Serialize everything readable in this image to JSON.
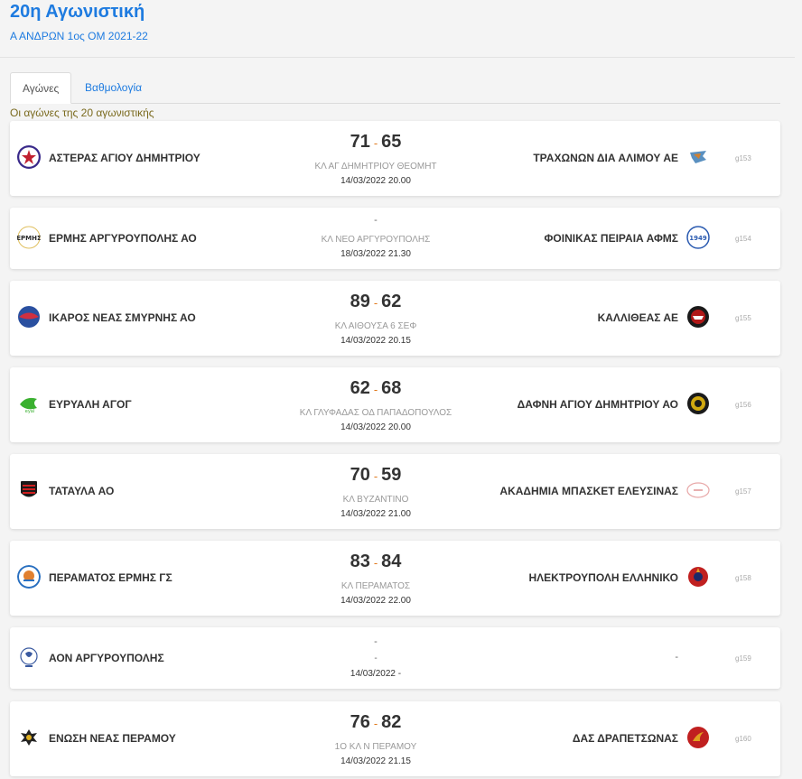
{
  "header": {
    "title": "20η Αγωνιστική",
    "subtitle": "Α ΑΝΔΡΩΝ 1ος ΟΜ 2021-22"
  },
  "tabs": [
    {
      "label": "Αγώνες"
    },
    {
      "label": "Βαθμολογία"
    }
  ],
  "caption": "Οι αγώνες της 20 αγωνιστικής",
  "matches": [
    {
      "home": "ΑΣΤΕΡΑΣ ΑΓΙΟΥ ΔΗΜΗΤΡΙΟΥ",
      "away": "ΤΡΑΧΩΝΩΝ ΔΙΑ ΑΛΙΜΟΥ ΑΕ",
      "home_score": "71",
      "away_score": "65",
      "venue": "ΚΛ ΑΓ ΔΗΜΗΤΡΙΟΥ ΘΕΟΜΗΤ",
      "date": "14/03/2022 20.00",
      "id": "g153",
      "home_color": "#3a2a8a",
      "away_color": "#5a90c0"
    },
    {
      "home": "ΕΡΜΗΣ ΑΡΓΥΡΟΥΠΟΛΗΣ ΑΟ",
      "away": "ΦΟΙΝΙΚΑΣ ΠΕΙΡΑΙΑ ΑΦΜΣ",
      "home_score": "",
      "away_score": "",
      "pending": "-",
      "venue": "ΚΛ ΝΕΟ ΑΡΓΥΡΟΥΠΟΛΗΣ",
      "date": "18/03/2022 21.30",
      "id": "g154",
      "home_color": "#c8a020",
      "away_color": "#2a5ab0"
    },
    {
      "home": "ΙΚΑΡΟΣ ΝΕΑΣ ΣΜΥΡΝΗΣ ΑΟ",
      "away": "ΚΑΛΛΙΘΕΑΣ ΑΕ",
      "home_score": "89",
      "away_score": "62",
      "venue": "ΚΛ ΑΙΘΟΥΣΑ 6 ΣΕΦ",
      "date": "14/03/2022 20.15",
      "id": "g155",
      "home_color": "#c03040",
      "away_color": "#b01818"
    },
    {
      "home": "ΕΥΡΥΑΛΗ ΑΓΟΓ",
      "away": "ΔΑΦΝΗ ΑΓΙΟΥ ΔΗΜΗΤΡΙΟΥ ΑΟ",
      "home_score": "62",
      "away_score": "68",
      "venue": "ΚΛ ΓΛΥΦΑΔΑΣ ΟΔ ΠΑΠΑΔΟΠΟΥΛΟΣ",
      "date": "14/03/2022 20.00",
      "id": "g156",
      "home_color": "#3ab030",
      "away_color": "#d0a810"
    },
    {
      "home": "ΤΑΤΑΥΛΑ ΑΟ",
      "away": "ΑΚΑΔΗΜΙΑ ΜΠΑΣΚΕΤ ΕΛΕΥΣΙΝΑΣ",
      "home_score": "70",
      "away_score": "59",
      "venue": "ΚΛ ΒΥΖΑΝΤΙΝΟ",
      "date": "14/03/2022 21.00",
      "id": "g157",
      "home_color": "#b01818",
      "away_color": "#e8a8a8"
    },
    {
      "home": "ΠΕΡΑΜΑΤΟΣ ΕΡΜΗΣ ΓΣ",
      "away": "ΗΛΕΚΤΡΟΥΠΟΛΗ ΕΛΛΗΝΙΚΟ",
      "home_score": "83",
      "away_score": "84",
      "venue": "ΚΛ ΠΕΡΑΜΑΤΟΣ",
      "date": "14/03/2022 22.00",
      "id": "g158",
      "home_color": "#2a70c0",
      "away_color": "#c02020"
    },
    {
      "home": "ΑΟΝ ΑΡΓΥΡΟΥΠΟΛΗΣ",
      "away": "",
      "away_placeholder": "-",
      "home_score": "",
      "away_score": "",
      "pending": "-",
      "venue": "-",
      "date": "14/03/2022 -",
      "id": "g159",
      "home_color": "#3a5aa0",
      "away_color": ""
    },
    {
      "home": "ΕΝΩΣΗ ΝΕΑΣ ΠΕΡΑΜΟΥ",
      "away": "ΔΑΣ ΔΡΑΠΕΤΣΩΝΑΣ",
      "home_score": "76",
      "away_score": "82",
      "venue": "1ο ΚΛ Ν ΠΕΡΑΜΟΥ",
      "date": "14/03/2022 21.15",
      "id": "g160",
      "home_color": "#222222",
      "away_color": "#c02020"
    }
  ]
}
